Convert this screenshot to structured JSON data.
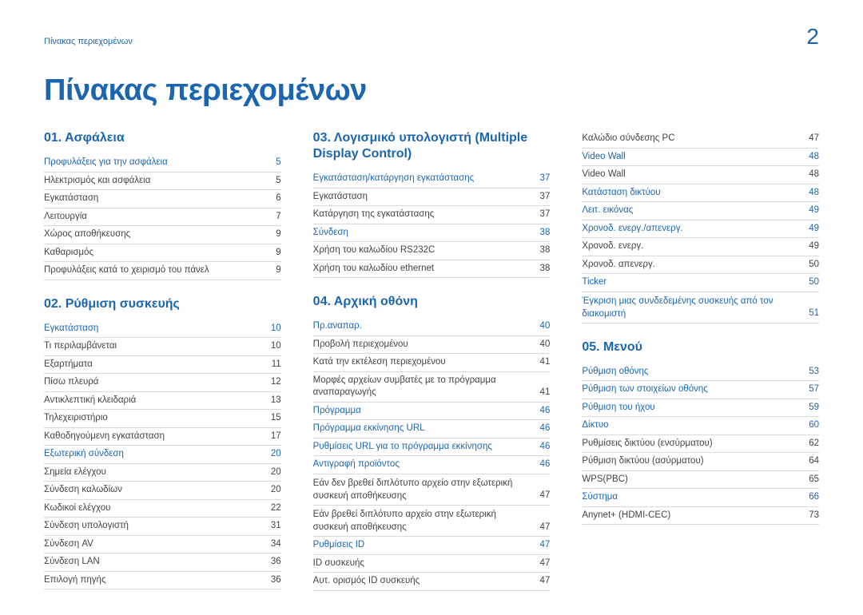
{
  "header": {
    "breadcrumb": "Πίνακας περιεχομένων",
    "page_number": "2"
  },
  "title": "Πίνακας περιεχομένων",
  "columns": [
    {
      "blocks": [
        {
          "heading": "01. Ασφάλεια",
          "items": [
            {
              "label": "Προφυλάξεις για την ασφάλεια",
              "page": "5",
              "link": true
            },
            {
              "label": "Ηλεκτρισμός και ασφάλεια",
              "page": "5"
            },
            {
              "label": "Εγκατάσταση",
              "page": "6"
            },
            {
              "label": "Λειτουργία",
              "page": "7"
            },
            {
              "label": "Χώρος αποθήκευσης",
              "page": "9"
            },
            {
              "label": "Καθαρισμός",
              "page": "9"
            },
            {
              "label": "Προφυλάξεις κατά το χειρισμό του πάνελ",
              "page": "9"
            }
          ]
        },
        {
          "heading": "02. Ρύθμιση συσκευής",
          "gap": true,
          "items": [
            {
              "label": "Εγκατάσταση",
              "page": "10",
              "link": true
            },
            {
              "label": "Τι περιλαμβάνεται",
              "page": "10"
            },
            {
              "label": "Εξαρτήματα",
              "page": "11"
            },
            {
              "label": "Πίσω πλευρά",
              "page": "12"
            },
            {
              "label": "Αντικλεπτική κλειδαριά",
              "page": "13"
            },
            {
              "label": "Τηλεχειριστήριο",
              "page": "15"
            },
            {
              "label": "Καθοδηγούμενη εγκατάσταση",
              "page": "17"
            },
            {
              "label": "Εξωτερική σύνδεση",
              "page": "20",
              "link": true
            },
            {
              "label": "Σημεία ελέγχου",
              "page": "20"
            },
            {
              "label": "Σύνδεση καλωδίων",
              "page": "20"
            },
            {
              "label": "Κωδικοί ελέγχου",
              "page": "22"
            },
            {
              "label": "Σύνδεση υπολογιστή",
              "page": "31"
            },
            {
              "label": "Σύνδεση AV",
              "page": "34"
            },
            {
              "label": "Σύνδεση LAN",
              "page": "36"
            },
            {
              "label": "Επιλογή πηγής",
              "page": "36"
            }
          ]
        }
      ]
    },
    {
      "blocks": [
        {
          "heading": "03. Λογισμικό υπολογιστή (Multiple Display Control)",
          "items": [
            {
              "label": "Εγκατάσταση/κατάργηση εγκατάστασης",
              "page": "37",
              "link": true
            },
            {
              "label": "Εγκατάσταση",
              "page": "37"
            },
            {
              "label": "Κατάργηση της εγκατάστασης",
              "page": "37"
            },
            {
              "label": "Σύνδεση",
              "page": "38",
              "link": true
            },
            {
              "label": "Χρήση του καλωδίου RS232C",
              "page": "38"
            },
            {
              "label": "Χρήση του καλωδίου ethernet",
              "page": "38"
            }
          ]
        },
        {
          "heading": "04. Αρχική οθόνη",
          "gap": true,
          "items": [
            {
              "label": "Πρ.αναπαρ.",
              "page": "40",
              "link": true
            },
            {
              "label": "Προβολή περιεχομένου",
              "page": "40"
            },
            {
              "label": "Κατά την εκτέλεση περιεχομένου",
              "page": "41"
            },
            {
              "label": "Μορφές αρχείων συμβατές με το πρόγραμμα αναπαραγωγής",
              "page": "41"
            },
            {
              "label": "Πρόγραμμα",
              "page": "46",
              "link": true
            },
            {
              "label": "Πρόγραμμα εκκίνησης URL",
              "page": "46",
              "link": true
            },
            {
              "label": "Ρυθμίσεις URL για το πρόγραμμα εκκίνησης",
              "page": "46",
              "link": true
            },
            {
              "label": "Αντιγραφή προϊόντος",
              "page": "46",
              "link": true
            },
            {
              "label": "Εάν δεν βρεθεί διπλότυπο αρχείο στην εξωτερική συσκευή αποθήκευσης",
              "page": "47",
              "wrap": true
            },
            {
              "label": "Εάν βρεθεί διπλότυπο αρχείο στην εξωτερική συσκευή αποθήκευσης",
              "page": "47",
              "wrap": true
            },
            {
              "label": "Ρυθμίσεις ID",
              "page": "47",
              "link": true
            },
            {
              "label": "ID συσκευής",
              "page": "47"
            },
            {
              "label": "Αυτ. ορισμός ID συσκευής",
              "page": "47"
            }
          ]
        }
      ]
    },
    {
      "blocks": [
        {
          "heading": "",
          "items": [
            {
              "label": "Καλώδιο σύνδεσης PC",
              "page": "47"
            },
            {
              "label": "Video Wall",
              "page": "48",
              "link": true
            },
            {
              "label": "Video Wall",
              "page": "48"
            },
            {
              "label": "Κατάσταση δικτύου",
              "page": "48",
              "link": true
            },
            {
              "label": "Λειτ. εικόνας",
              "page": "49",
              "link": true
            },
            {
              "label": "Χρονοδ. ενεργ./απενεργ.",
              "page": "49",
              "link": true
            },
            {
              "label": "Χρονοδ. ενεργ.",
              "page": "49"
            },
            {
              "label": "Χρονοδ. απενεργ.",
              "page": "50"
            },
            {
              "label": "Ticker",
              "page": "50",
              "link": true
            },
            {
              "label": "Έγκριση μιας συνδεδεμένης συσκευής από τον διακομιστή",
              "page": "51",
              "link": true,
              "wrap": true
            }
          ]
        },
        {
          "heading": "05. Μενού",
          "gap": true,
          "items": [
            {
              "label": "Ρύθμιση οθόνης",
              "page": "53",
              "link": true
            },
            {
              "label": "Ρύθμιση των στοιχείων οθόνης",
              "page": "57",
              "link": true
            },
            {
              "label": "Ρύθμιση του ήχου",
              "page": "59",
              "link": true
            },
            {
              "label": "Δίκτυο",
              "page": "60",
              "link": true
            },
            {
              "label": "Ρυθμίσεις δικτύου (ενσύρματου)",
              "page": "62"
            },
            {
              "label": "Ρύθμιση δικτύου (ασύρματου)",
              "page": "64"
            },
            {
              "label": "WPS(PBC)",
              "page": "65"
            },
            {
              "label": "Σύστημα",
              "page": "66",
              "link": true
            },
            {
              "label": "Anynet+ (HDMI-CEC)",
              "page": "73"
            }
          ]
        }
      ]
    }
  ]
}
